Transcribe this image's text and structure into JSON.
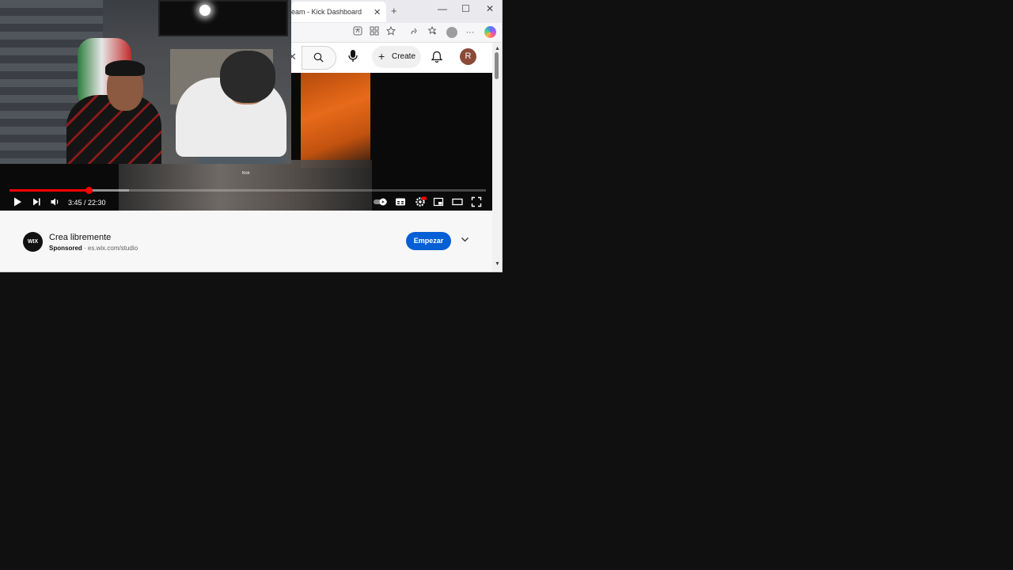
{
  "browser": {
    "tab": {
      "title": "eam - Kick Dashboard",
      "close": "✕"
    },
    "new_tab": "+",
    "window_controls": {
      "minimize": "—",
      "maximize": "☐",
      "close": "✕"
    },
    "toolbar_icons": [
      "translate-icon",
      "extensions-icon",
      "favorite-star-icon",
      "split-screen-icon",
      "favorites-icon",
      "profile-icon",
      "more-icon",
      "copilot-icon"
    ],
    "more_label": "···"
  },
  "youtube": {
    "header": {
      "search_clear": "✕",
      "create_label": "Create",
      "create_plus": "+",
      "avatar_letter": "R"
    },
    "player": {
      "time": "3:45 / 22:30",
      "progress": 0.1667,
      "watermark": "Kick",
      "icons": [
        "play-icon",
        "next-icon",
        "volume-icon",
        "autoplay-toggle-icon",
        "subtitles-icon",
        "settings-icon",
        "miniplayer-icon",
        "theater-icon",
        "fullscreen-icon"
      ]
    },
    "ad": {
      "logo_text": "WIX",
      "title": "Crea libremente",
      "sponsored": "Sponsored",
      "separator": "·",
      "domain": "es.wix.com/studio",
      "cta": "Empezar"
    }
  },
  "colors": {
    "accent_red": "#ff0000",
    "cta_blue": "#065fd4",
    "desktop_bg": "#101010"
  }
}
